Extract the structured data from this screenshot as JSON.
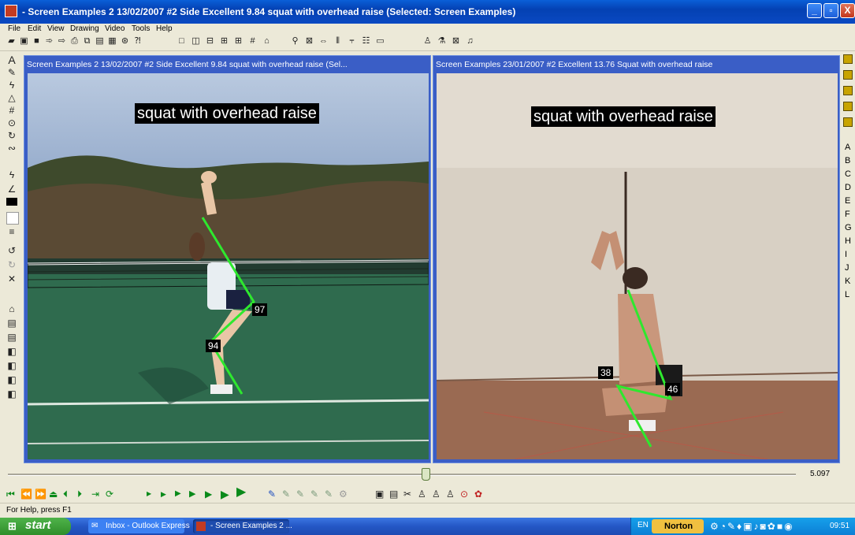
{
  "window": {
    "title": "- Screen Examples 2   13/02/2007   #2   Side   Excellent   9.84   squat with overhead raise   (Selected: Screen Examples)",
    "min": "_",
    "max": "▫",
    "close": "X"
  },
  "menu": [
    "File",
    "Edit",
    "View",
    "Drawing",
    "Video",
    "Tools",
    "Help"
  ],
  "panels": [
    {
      "title": "Screen Examples 2   13/02/2007   #2   Side   Excellent   9.84   squat with overhead raise   (Sel...",
      "caption": "squat with overhead raise",
      "angles": [
        "97",
        "94"
      ]
    },
    {
      "title": "Screen Examples   23/01/2007   #2   Excellent   13.76   Squat with overhead raise",
      "caption": "squat with overhead raise",
      "angles": [
        "38",
        "46"
      ]
    }
  ],
  "right_letters": [
    "A",
    "B",
    "C",
    "D",
    "E",
    "F",
    "G",
    "H",
    "I",
    "J",
    "K",
    "L"
  ],
  "timeline": {
    "value": "5.097",
    "position": 0.53
  },
  "status": "For Help, press F1",
  "taskbar": {
    "start": "start",
    "items": [
      "Inbox - Outlook Express",
      "- Screen Examples 2 ..."
    ],
    "lang": "EN",
    "norton": "Norton",
    "clock": "09:51"
  },
  "colors": {
    "accent": "#0a49c2",
    "overlay_line": "#2ee82e",
    "panel_border": "#3a5ec6"
  }
}
